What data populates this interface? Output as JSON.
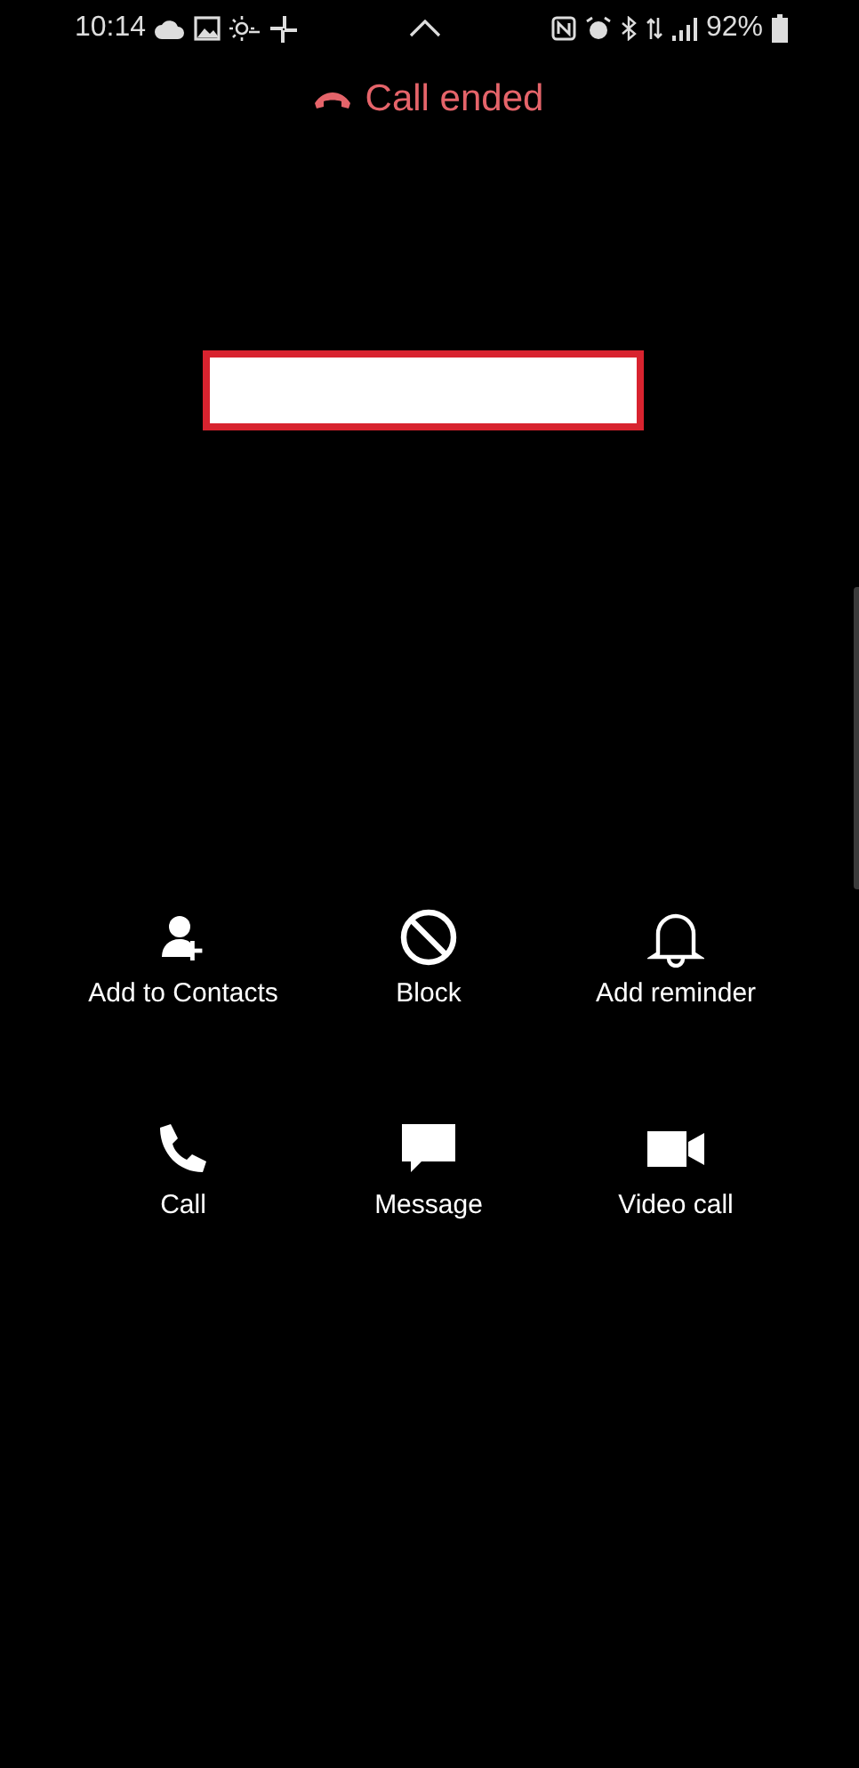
{
  "status_bar": {
    "time": "10:14",
    "battery": "92%"
  },
  "call_status": {
    "text": "Call ended"
  },
  "caller": {
    "redacted": true
  },
  "actions": [
    {
      "kind": "add-contact",
      "label": "Add to Contacts"
    },
    {
      "kind": "block",
      "label": "Block"
    },
    {
      "kind": "reminder",
      "label": "Add reminder"
    },
    {
      "kind": "call",
      "label": "Call"
    },
    {
      "kind": "message",
      "label": "Message"
    },
    {
      "kind": "video",
      "label": "Video call"
    }
  ]
}
